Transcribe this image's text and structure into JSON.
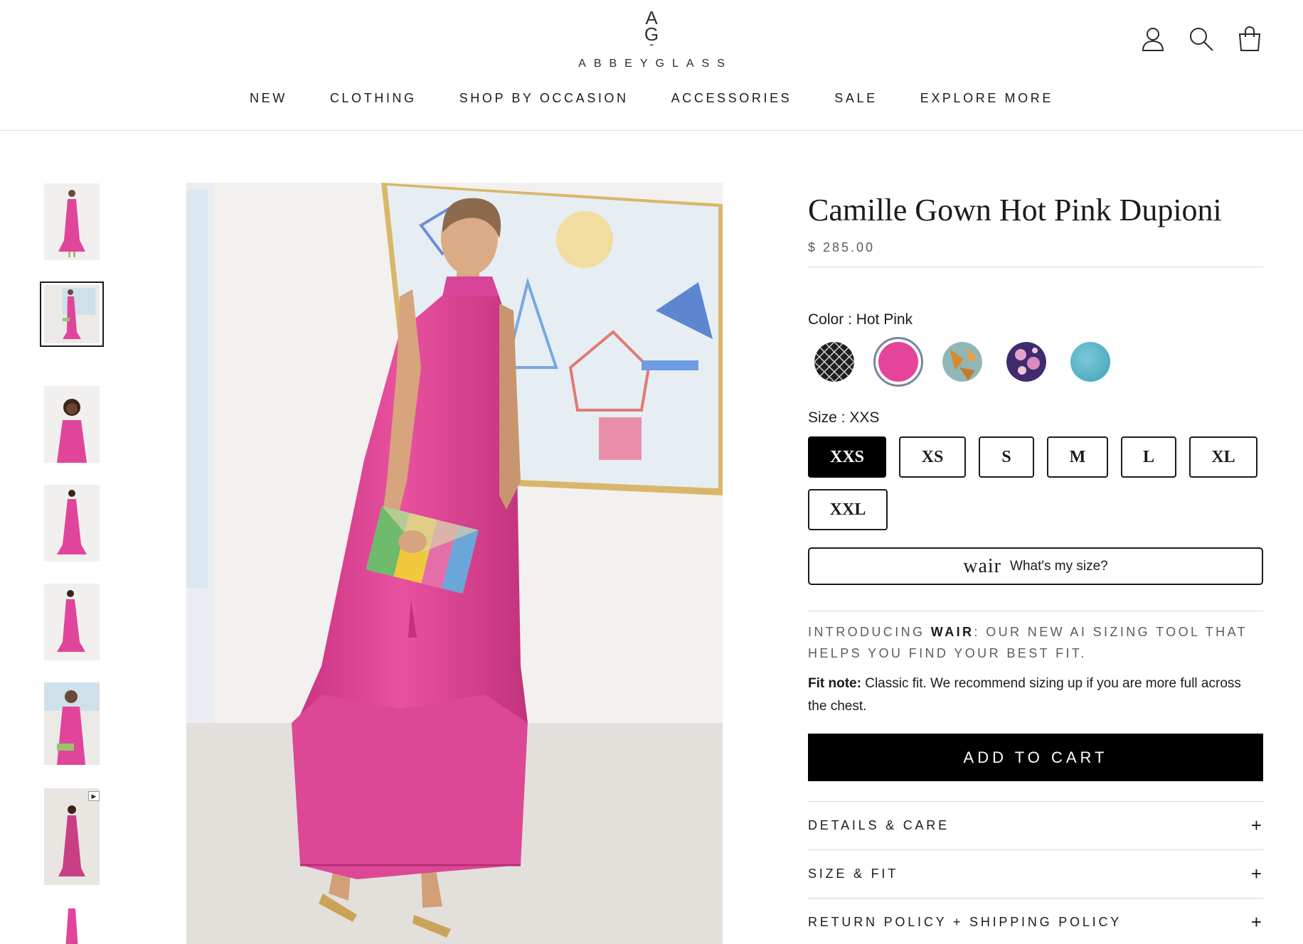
{
  "brand": {
    "mark_top": "A",
    "mark_bottom": "G",
    "mark_dash": "-",
    "name": "ABBEYGLASS"
  },
  "header_icons": [
    "account-icon",
    "search-icon",
    "cart-icon"
  ],
  "nav": [
    "NEW",
    "CLOTHING",
    "SHOP BY OCCASION",
    "ACCESSORIES",
    "SALE",
    "EXPLORE MORE"
  ],
  "thumbnails": [
    {
      "name": "thumb-1",
      "selected": false
    },
    {
      "name": "thumb-2",
      "selected": true
    },
    {
      "name": "thumb-3",
      "selected": false
    },
    {
      "name": "thumb-4",
      "selected": false
    },
    {
      "name": "thumb-5",
      "selected": false
    },
    {
      "name": "thumb-6",
      "selected": false
    },
    {
      "name": "thumb-7-video",
      "selected": false,
      "video": true
    },
    {
      "name": "thumb-8",
      "selected": false
    }
  ],
  "product": {
    "title": "Camille Gown Hot Pink Dupioni",
    "price": "$ 285.00",
    "color_label": "Color : ",
    "color_value": "Hot Pink",
    "colors": [
      {
        "name": "black-white-pattern",
        "color": "#1f1f1f",
        "active": false
      },
      {
        "name": "hot-pink",
        "color": "#e4449a",
        "active": true
      },
      {
        "name": "orange-teal-print",
        "color": "#c9904a",
        "active": false
      },
      {
        "name": "purple-floral",
        "color": "#6a3f86",
        "active": false
      },
      {
        "name": "teal",
        "color": "#4fb0c4",
        "active": false
      }
    ],
    "size_label": "Size : ",
    "size_value": "XXS",
    "sizes": [
      {
        "label": "XXS",
        "active": true
      },
      {
        "label": "XS",
        "active": false
      },
      {
        "label": "S",
        "active": false
      },
      {
        "label": "M",
        "active": false
      },
      {
        "label": "L",
        "active": false
      },
      {
        "label": "XL",
        "active": false
      },
      {
        "label": "XXL",
        "active": false
      }
    ],
    "wair_logo": "wair",
    "wair_text": "What's my size?",
    "intro_pre": "INTRODUCING ",
    "intro_brand": "WAIR",
    "intro_post": ": OUR NEW AI SIZING TOOL THAT HELPS YOU FIND YOUR BEST FIT.",
    "fit_note_label": "Fit note:",
    "fit_note_text": " Classic fit. We recommend sizing up if you are more full across the chest.",
    "add_to_cart": "ADD TO CART",
    "accordion": [
      "DETAILS & CARE",
      "SIZE & FIT",
      "RETURN POLICY + SHIPPING POLICY"
    ],
    "accordion_icon": "+"
  },
  "colors": {
    "accent": "#000000",
    "dress": "#e0459b",
    "swatch_ring": "#7a8699"
  }
}
